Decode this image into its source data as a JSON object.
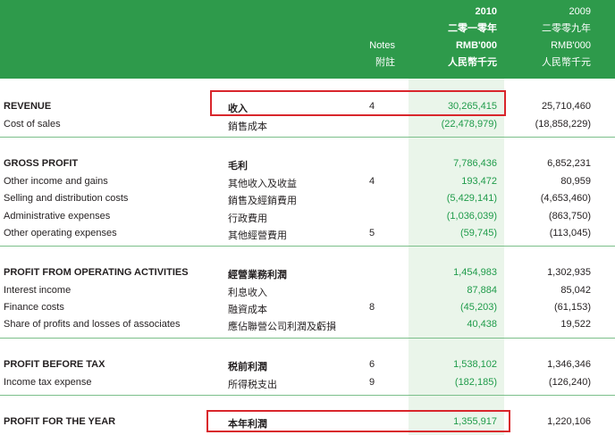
{
  "header": {
    "notes": [
      "Notes",
      "附註"
    ],
    "year_2010": [
      "2010",
      "二零一零年",
      "RMB'000",
      "人民幣千元"
    ],
    "year_2009": [
      "2009",
      "二零零九年",
      "RMB'000",
      "人民幣千元"
    ]
  },
  "rows": [
    {
      "en": "REVENUE",
      "zh": "收入",
      "note": "4",
      "v2010": "30,265,415",
      "v2009": "25,710,460"
    },
    {
      "en": "Cost of sales",
      "zh": "銷售成本",
      "note": "",
      "v2010": "(22,478,979)",
      "v2009": "(18,858,229)"
    },
    {
      "en": "GROSS PROFIT",
      "zh": "毛利",
      "note": "",
      "v2010": "7,786,436",
      "v2009": "6,852,231"
    },
    {
      "en": "Other income and gains",
      "zh": "其他收入及收益",
      "note": "4",
      "v2010": "193,472",
      "v2009": "80,959"
    },
    {
      "en": "Selling and distribution costs",
      "zh": "銷售及經銷費用",
      "note": "",
      "v2010": "(5,429,141)",
      "v2009": "(4,653,460)"
    },
    {
      "en": "Administrative expenses",
      "zh": "行政費用",
      "note": "",
      "v2010": "(1,036,039)",
      "v2009": "(863,750)"
    },
    {
      "en": "Other operating expenses",
      "zh": "其他經營費用",
      "note": "5",
      "v2010": "(59,745)",
      "v2009": "(113,045)"
    },
    {
      "en": "PROFIT FROM OPERATING ACTIVITIES",
      "zh": "經營業務利潤",
      "note": "",
      "v2010": "1,454,983",
      "v2009": "1,302,935"
    },
    {
      "en": "Interest income",
      "zh": "利息收入",
      "note": "",
      "v2010": "87,884",
      "v2009": "85,042"
    },
    {
      "en": "Finance costs",
      "zh": "融資成本",
      "note": "8",
      "v2010": "(45,203)",
      "v2009": "(61,153)"
    },
    {
      "en": "Share of profits and losses of associates",
      "zh": "應佔聯營公司利潤及虧損",
      "note": "",
      "v2010": "40,438",
      "v2009": "19,522"
    },
    {
      "en": "PROFIT BEFORE TAX",
      "zh": "税前利潤",
      "note": "6",
      "v2010": "1,538,102",
      "v2009": "1,346,346"
    },
    {
      "en": "Income tax expense",
      "zh": "所得税支出",
      "note": "9",
      "v2010": "(182,185)",
      "v2009": "(126,240)"
    },
    {
      "en": "PROFIT FOR THE YEAR",
      "zh": "本年利潤",
      "note": "",
      "v2010": "1,355,917",
      "v2009": "1,220,106"
    }
  ]
}
